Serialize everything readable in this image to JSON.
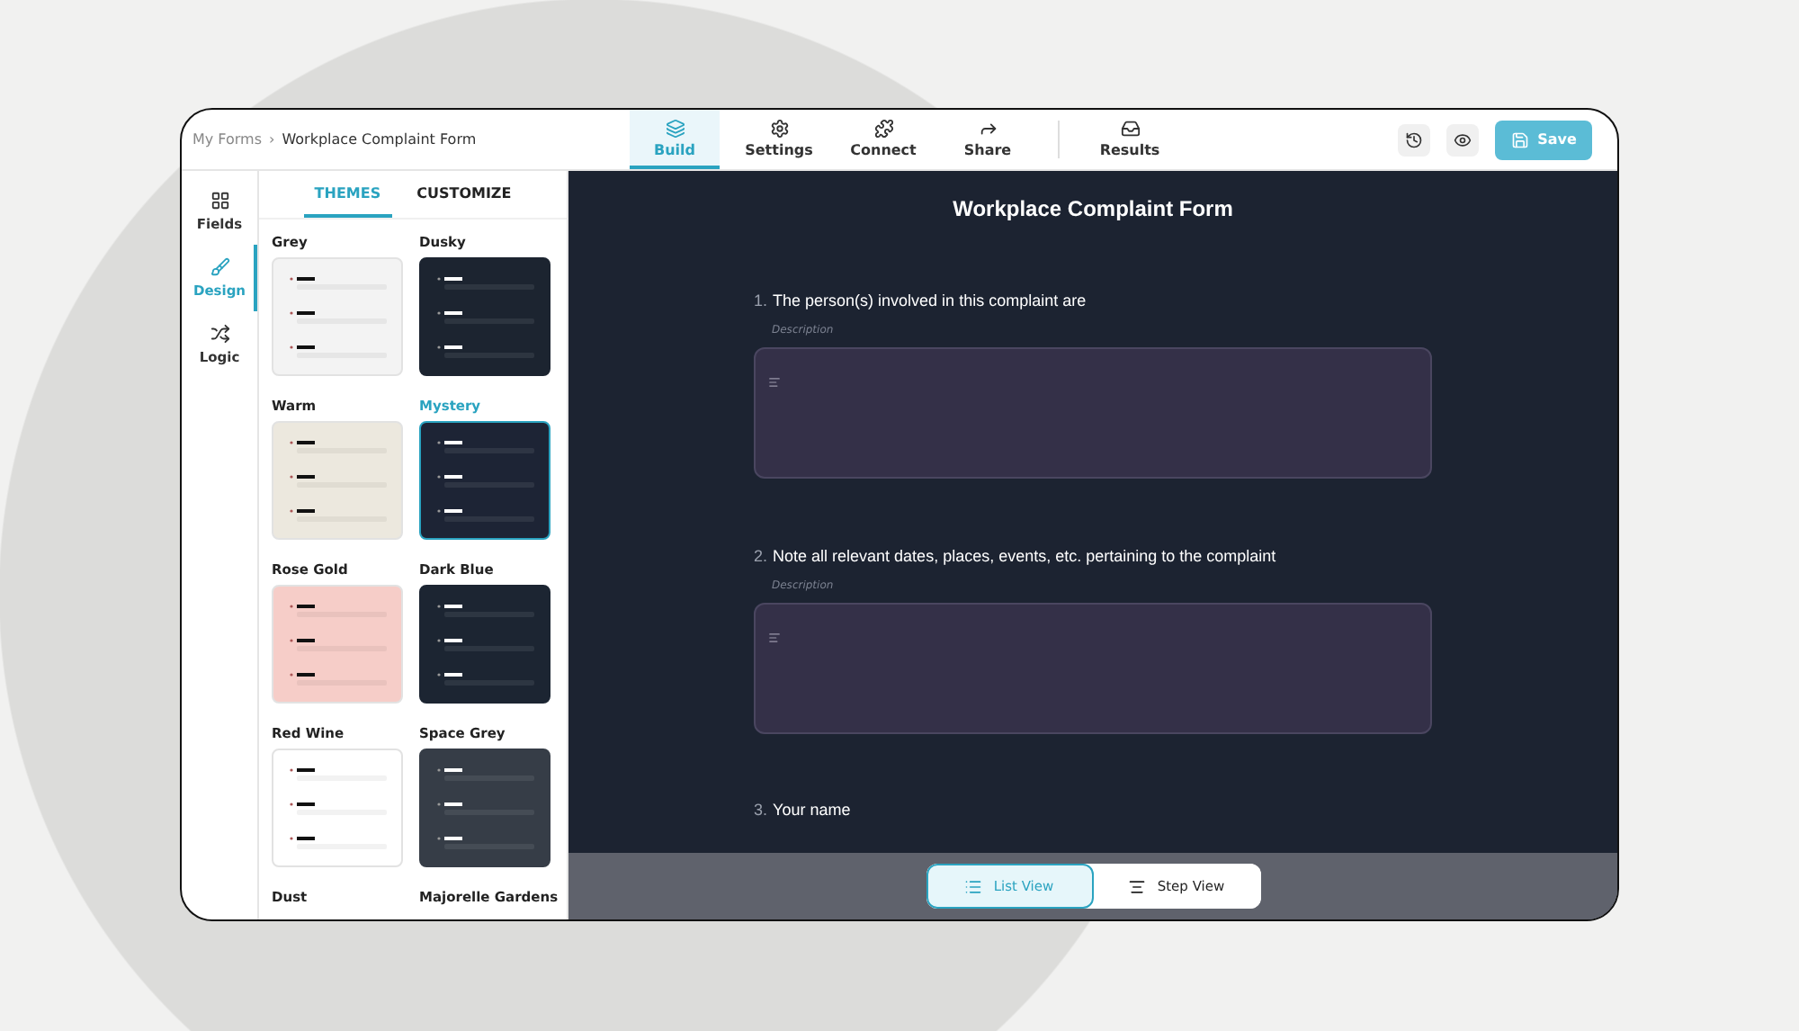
{
  "breadcrumb": {
    "parent": "My Forms",
    "separator": "›",
    "current": "Workplace Complaint Form"
  },
  "nav_tabs": [
    {
      "label": "Build",
      "selected": true
    },
    {
      "label": "Settings",
      "selected": false
    },
    {
      "label": "Connect",
      "selected": false
    },
    {
      "label": "Share",
      "selected": false
    },
    {
      "label": "Results",
      "selected": false
    }
  ],
  "save_button": {
    "label": "Save"
  },
  "rail": [
    {
      "label": "Fields",
      "selected": false
    },
    {
      "label": "Design",
      "selected": true
    },
    {
      "label": "Logic",
      "selected": false
    }
  ],
  "panel_tabs": [
    {
      "label": "THEMES",
      "selected": true
    },
    {
      "label": "CUSTOMIZE",
      "selected": false
    }
  ],
  "themes": [
    {
      "name": "Grey",
      "selected": false,
      "color": "#f3f3f3"
    },
    {
      "name": "Dusky",
      "selected": false,
      "color": "#1c2430"
    },
    {
      "name": "Warm",
      "selected": false,
      "color": "#ece8de"
    },
    {
      "name": "Mystery",
      "selected": true,
      "color": "#1d2435"
    },
    {
      "name": "Rose Gold",
      "selected": false,
      "color": "#f6cdc8"
    },
    {
      "name": "Dark Blue",
      "selected": false,
      "color": "#1c2532"
    },
    {
      "name": "Red Wine",
      "selected": false,
      "color": "#ffffff"
    },
    {
      "name": "Space Grey",
      "selected": false,
      "color": "#363d47"
    },
    {
      "name": "Dust",
      "selected": false
    },
    {
      "name": "Majorelle Gardens",
      "selected": false
    }
  ],
  "form": {
    "title": "Workplace Complaint Form",
    "questions": [
      {
        "number": "1.",
        "text": "The person(s) involved in this complaint are",
        "description": "Description"
      },
      {
        "number": "2.",
        "text": "Note all relevant dates, places, events, etc. pertaining to the complaint",
        "description": "Description"
      },
      {
        "number": "3.",
        "text": "Your name"
      }
    ]
  },
  "view_toggle": [
    {
      "label": "List View",
      "selected": true
    },
    {
      "label": "Step View",
      "selected": false
    }
  ]
}
